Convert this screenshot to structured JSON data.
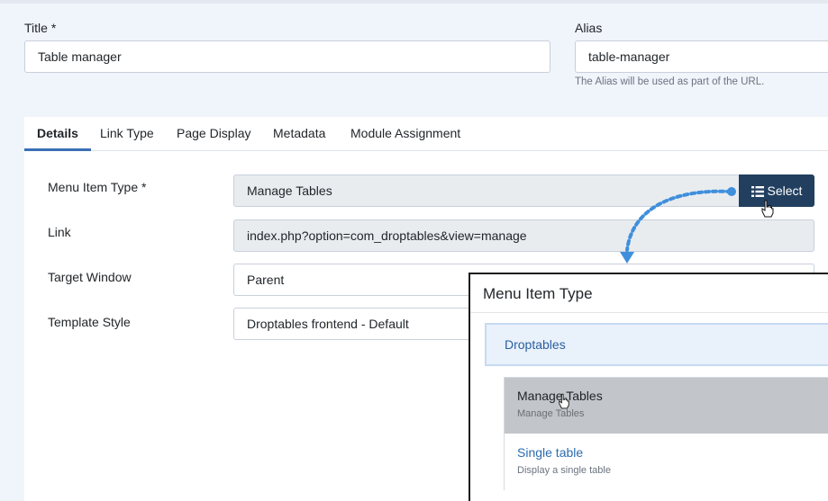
{
  "form": {
    "title_label": "Title *",
    "title_value": "Table manager",
    "alias_label": "Alias",
    "alias_value": "table-manager",
    "alias_help": "The Alias will be used as part of the URL."
  },
  "tabs": [
    {
      "label": "Details",
      "active": true
    },
    {
      "label": "Link Type",
      "active": false
    },
    {
      "label": "Page Display",
      "active": false
    },
    {
      "label": "Metadata",
      "active": false
    },
    {
      "label": "Module Assignment",
      "active": false
    }
  ],
  "details": {
    "menu_item_type_label": "Menu Item Type *",
    "menu_item_type_value": "Manage Tables",
    "select_button_label": "Select",
    "link_label": "Link",
    "link_value": "index.php?option=com_droptables&view=manage",
    "target_window_label": "Target Window",
    "target_window_value": "Parent",
    "template_style_label": "Template Style",
    "template_style_value": "Droptables frontend - Default"
  },
  "modal": {
    "title": "Menu Item Type",
    "group": "Droptables",
    "items": [
      {
        "title": "Manage Tables",
        "description": "Manage Tables",
        "hovered": true
      },
      {
        "title": "Single table",
        "description": "Display a single table",
        "hovered": false
      }
    ]
  },
  "colors": {
    "accent": "#3a6fb5",
    "button_bg": "#223f5f",
    "link_blue": "#2b6cb0",
    "annotation_arrow": "#3f8fdc"
  },
  "icons": {
    "select_button": "list-icon",
    "cursor": "hand-pointer-icon",
    "annotation": "dotted-arrow-icon"
  }
}
